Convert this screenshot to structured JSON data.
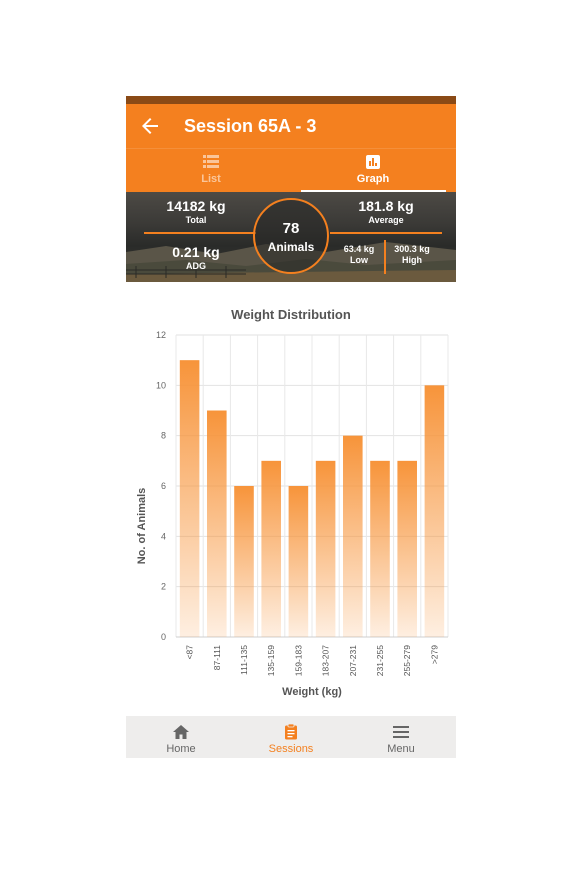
{
  "header": {
    "title": "Session 65A - 3"
  },
  "tabs": [
    {
      "label": "List",
      "icon": "list-icon",
      "active": false
    },
    {
      "label": "Graph",
      "icon": "bar-chart-icon",
      "active": true
    }
  ],
  "summary": {
    "total": {
      "value": "14182 kg",
      "label": "Total"
    },
    "average": {
      "value": "181.8 kg",
      "label": "Average"
    },
    "adg": {
      "value": "0.21 kg",
      "label": "ADG"
    },
    "animals": {
      "count": "78",
      "label": "Animals"
    },
    "low": {
      "value": "63.4 kg",
      "label": "Low"
    },
    "high": {
      "value": "300.3 kg",
      "label": "High"
    }
  },
  "chart_data": {
    "type": "bar",
    "title": "Weight Distribution",
    "xlabel": "Weight (kg)",
    "ylabel": "No. of Animals",
    "categories": [
      "<87",
      "87-111",
      "111-135",
      "135-159",
      "159-183",
      "183-207",
      "207-231",
      "231-255",
      "255-279",
      ">279"
    ],
    "values": [
      11,
      9,
      6,
      7,
      6,
      7,
      8,
      7,
      7,
      10
    ],
    "ylim": [
      0,
      12
    ],
    "yticks": [
      0,
      2,
      4,
      6,
      8,
      10,
      12
    ],
    "grid": true,
    "bar_color": "#f7943a"
  },
  "bottom_nav": [
    {
      "label": "Home",
      "icon": "home-icon",
      "active": false
    },
    {
      "label": "Sessions",
      "icon": "clipboard-icon",
      "active": true
    },
    {
      "label": "Menu",
      "icon": "hamburger-icon",
      "active": false
    }
  ],
  "colors": {
    "accent": "#f4801f",
    "status_bar": "#8a4a16"
  }
}
